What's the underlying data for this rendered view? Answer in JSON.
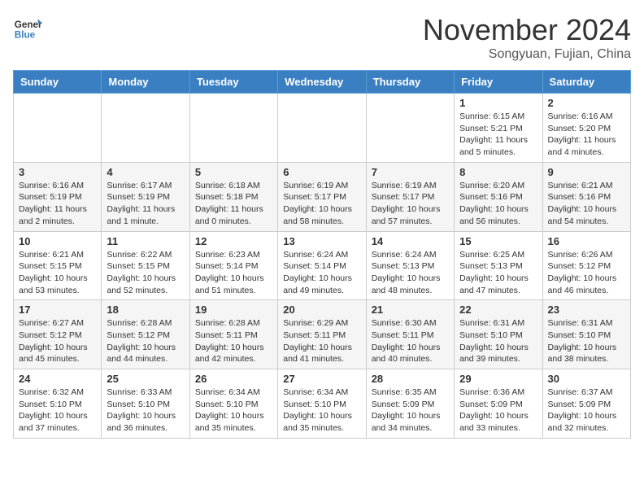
{
  "header": {
    "logo_line1": "General",
    "logo_line2": "Blue",
    "month_title": "November 2024",
    "location": "Songyuan, Fujian, China"
  },
  "weekdays": [
    "Sunday",
    "Monday",
    "Tuesday",
    "Wednesday",
    "Thursday",
    "Friday",
    "Saturday"
  ],
  "weeks": [
    [
      {
        "day": "",
        "info": ""
      },
      {
        "day": "",
        "info": ""
      },
      {
        "day": "",
        "info": ""
      },
      {
        "day": "",
        "info": ""
      },
      {
        "day": "",
        "info": ""
      },
      {
        "day": "1",
        "info": "Sunrise: 6:15 AM\nSunset: 5:21 PM\nDaylight: 11 hours\nand 5 minutes."
      },
      {
        "day": "2",
        "info": "Sunrise: 6:16 AM\nSunset: 5:20 PM\nDaylight: 11 hours\nand 4 minutes."
      }
    ],
    [
      {
        "day": "3",
        "info": "Sunrise: 6:16 AM\nSunset: 5:19 PM\nDaylight: 11 hours\nand 2 minutes."
      },
      {
        "day": "4",
        "info": "Sunrise: 6:17 AM\nSunset: 5:19 PM\nDaylight: 11 hours\nand 1 minute."
      },
      {
        "day": "5",
        "info": "Sunrise: 6:18 AM\nSunset: 5:18 PM\nDaylight: 11 hours\nand 0 minutes."
      },
      {
        "day": "6",
        "info": "Sunrise: 6:19 AM\nSunset: 5:17 PM\nDaylight: 10 hours\nand 58 minutes."
      },
      {
        "day": "7",
        "info": "Sunrise: 6:19 AM\nSunset: 5:17 PM\nDaylight: 10 hours\nand 57 minutes."
      },
      {
        "day": "8",
        "info": "Sunrise: 6:20 AM\nSunset: 5:16 PM\nDaylight: 10 hours\nand 56 minutes."
      },
      {
        "day": "9",
        "info": "Sunrise: 6:21 AM\nSunset: 5:16 PM\nDaylight: 10 hours\nand 54 minutes."
      }
    ],
    [
      {
        "day": "10",
        "info": "Sunrise: 6:21 AM\nSunset: 5:15 PM\nDaylight: 10 hours\nand 53 minutes."
      },
      {
        "day": "11",
        "info": "Sunrise: 6:22 AM\nSunset: 5:15 PM\nDaylight: 10 hours\nand 52 minutes."
      },
      {
        "day": "12",
        "info": "Sunrise: 6:23 AM\nSunset: 5:14 PM\nDaylight: 10 hours\nand 51 minutes."
      },
      {
        "day": "13",
        "info": "Sunrise: 6:24 AM\nSunset: 5:14 PM\nDaylight: 10 hours\nand 49 minutes."
      },
      {
        "day": "14",
        "info": "Sunrise: 6:24 AM\nSunset: 5:13 PM\nDaylight: 10 hours\nand 48 minutes."
      },
      {
        "day": "15",
        "info": "Sunrise: 6:25 AM\nSunset: 5:13 PM\nDaylight: 10 hours\nand 47 minutes."
      },
      {
        "day": "16",
        "info": "Sunrise: 6:26 AM\nSunset: 5:12 PM\nDaylight: 10 hours\nand 46 minutes."
      }
    ],
    [
      {
        "day": "17",
        "info": "Sunrise: 6:27 AM\nSunset: 5:12 PM\nDaylight: 10 hours\nand 45 minutes."
      },
      {
        "day": "18",
        "info": "Sunrise: 6:28 AM\nSunset: 5:12 PM\nDaylight: 10 hours\nand 44 minutes."
      },
      {
        "day": "19",
        "info": "Sunrise: 6:28 AM\nSunset: 5:11 PM\nDaylight: 10 hours\nand 42 minutes."
      },
      {
        "day": "20",
        "info": "Sunrise: 6:29 AM\nSunset: 5:11 PM\nDaylight: 10 hours\nand 41 minutes."
      },
      {
        "day": "21",
        "info": "Sunrise: 6:30 AM\nSunset: 5:11 PM\nDaylight: 10 hours\nand 40 minutes."
      },
      {
        "day": "22",
        "info": "Sunrise: 6:31 AM\nSunset: 5:10 PM\nDaylight: 10 hours\nand 39 minutes."
      },
      {
        "day": "23",
        "info": "Sunrise: 6:31 AM\nSunset: 5:10 PM\nDaylight: 10 hours\nand 38 minutes."
      }
    ],
    [
      {
        "day": "24",
        "info": "Sunrise: 6:32 AM\nSunset: 5:10 PM\nDaylight: 10 hours\nand 37 minutes."
      },
      {
        "day": "25",
        "info": "Sunrise: 6:33 AM\nSunset: 5:10 PM\nDaylight: 10 hours\nand 36 minutes."
      },
      {
        "day": "26",
        "info": "Sunrise: 6:34 AM\nSunset: 5:10 PM\nDaylight: 10 hours\nand 35 minutes."
      },
      {
        "day": "27",
        "info": "Sunrise: 6:34 AM\nSunset: 5:10 PM\nDaylight: 10 hours\nand 35 minutes."
      },
      {
        "day": "28",
        "info": "Sunrise: 6:35 AM\nSunset: 5:09 PM\nDaylight: 10 hours\nand 34 minutes."
      },
      {
        "day": "29",
        "info": "Sunrise: 6:36 AM\nSunset: 5:09 PM\nDaylight: 10 hours\nand 33 minutes."
      },
      {
        "day": "30",
        "info": "Sunrise: 6:37 AM\nSunset: 5:09 PM\nDaylight: 10 hours\nand 32 minutes."
      }
    ]
  ]
}
